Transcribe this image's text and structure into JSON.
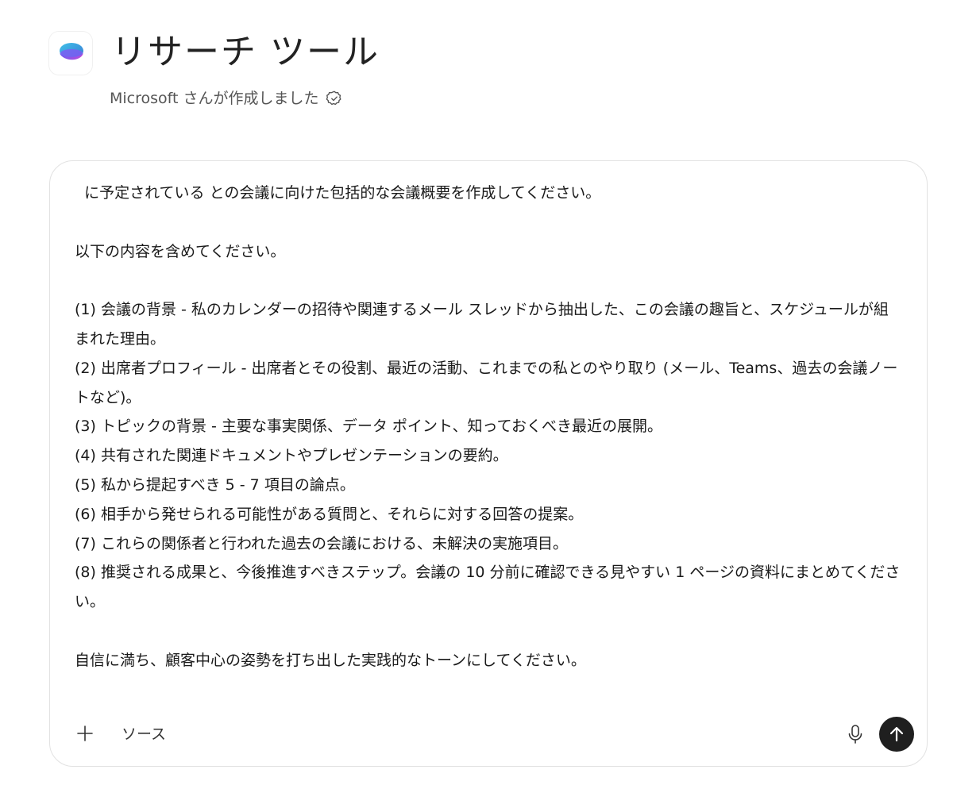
{
  "agent": {
    "title": "リサーチ ツール",
    "creator": "Microsoft さんが作成しました",
    "logo_icon": "copilot-logo-icon",
    "verified_icon": "verified-badge-icon"
  },
  "composer": {
    "prompt_lines": [
      "  に予定されている との会議に向けた包括的な会議概要を作成してください。",
      "",
      "以下の内容を含めてください。",
      "",
      "(1) 会議の背景 - 私のカレンダーの招待や関連するメール スレッドから抽出した、この会議の趣旨と、スケジュールが組まれた理由。",
      "(2) 出席者プロフィール - 出席者とその役割、最近の活動、これまでの私とのやり取り (メール、Teams、過去の会議ノートなど)。",
      "(3) トピックの背景 - 主要な事実関係、データ ポイント、知っておくべき最近の展開。",
      "(4) 共有された関連ドキュメントやプレゼンテーションの要約。",
      "(5) 私から提起すべき 5 - 7 項目の論点。",
      "(6) 相手から発せられる可能性がある質問と、それらに対する回答の提案。",
      "(7) これらの関係者と行われた過去の会議における、未解決の実施項目。",
      "(8) 推奨される成果と、今後推進すべきステップ。会議の 10 分前に確認できる見やすい 1 ページの資料にまとめてください。",
      "",
      "自信に満ち、顧客中心の姿勢を打ち出した実践的なトーンにしてください。"
    ],
    "sources_label": "ソース",
    "icons": {
      "add": "plus-icon",
      "mic": "microphone-icon",
      "send": "arrow-up-icon"
    }
  }
}
